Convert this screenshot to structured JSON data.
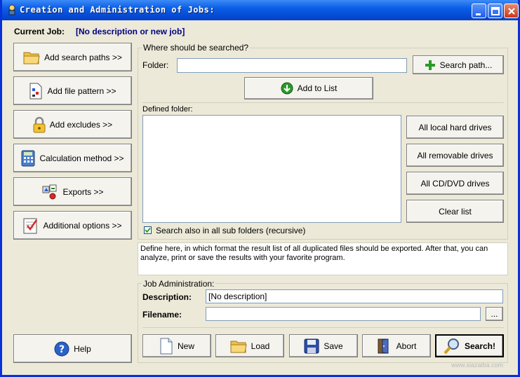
{
  "window": {
    "title": "Creation and Administration of Jobs:",
    "minimize_label": "_",
    "maximize_label": "□",
    "close_label": "X"
  },
  "current_job": {
    "label": "Current Job:",
    "value": "[No description or new job]"
  },
  "sidebar": {
    "items": [
      {
        "label": "Add search paths >>",
        "icon": "folder-icon"
      },
      {
        "label": "Add file pattern >>",
        "icon": "file-pattern-icon"
      },
      {
        "label": "Add excludes >>",
        "icon": "lock-icon"
      },
      {
        "label": "Calculation method >>",
        "icon": "calculator-icon"
      },
      {
        "label": "Exports >>",
        "icon": "exports-icon"
      },
      {
        "label": "Additional options >>",
        "icon": "checklist-icon"
      }
    ],
    "help_label": "Help"
  },
  "search_group": {
    "title": "Where should be searched?",
    "folder_label": "Folder:",
    "folder_value": "",
    "search_path_button": "Search path...",
    "add_to_list_button": "Add to List",
    "defined_folder_label": "Defined folder:",
    "side_buttons": [
      "All local hard drives",
      "All removable drives",
      "All CD/DVD drives",
      "Clear list"
    ],
    "recursive_label": "Search also in all sub folders (recursive)",
    "recursive_checked": true
  },
  "description_text": "Define here, in which format the result list of all duplicated files should be exported. After that, you can analyze, print or save the results with your favorite program.",
  "job_admin": {
    "title": "Job Administration:",
    "description_label": "Description:",
    "description_value": "[No description]",
    "filename_label": "Filename:",
    "filename_value": "",
    "browse_label": "..."
  },
  "actions": {
    "new": "New",
    "load": "Load",
    "save": "Save",
    "abort": "Abort",
    "search": "Search!"
  },
  "watermark": "www.xiazaiba.com"
}
